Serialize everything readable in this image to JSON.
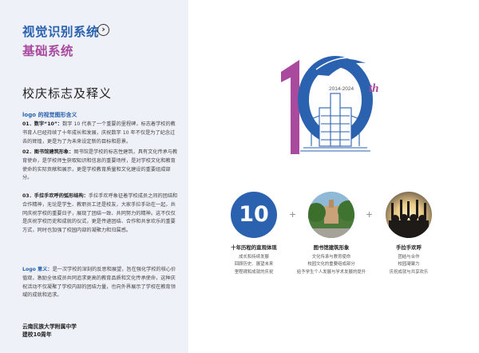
{
  "header": {
    "title_primary": "视觉识别系统",
    "title_secondary": "基础系统"
  },
  "section": {
    "title": "校庆标志及释义",
    "subtitle": "logo 的视觉图形含义",
    "items": [
      {
        "head": "01．数字“10”：",
        "text": "数字 10 代表了一个重要的里程碑，标志着学校的教书育人已经持续了十年成长和发展，庆祝数字 10 年不仅是为了纪念过去的辉煌，更是为了为未来设定新的目标和愿景。"
      },
      {
        "head": "02．图书馆建筑形象：",
        "text": "图书馆是学校的标志性建筑，具有文化传承与教育使命，是学校师生获取知识和信息的重要场所，是对学校文化和教育使命的实际贡献和展示，更是学校教育质量和文化建设的重要组成部分。"
      },
      {
        "head": "03．手拉手欢呼的弧形结构：",
        "text": "手拉手欢呼象征着学校成员之间的团结和合作精神，无论是学生、教职员工还是校友，大家手拉手站在一起，共同庆祝学校的重要日子，展现了团结一致、共同努力的精神。这不仅仅是庆祝学校历史和成就的仪式，更是传递团结、合作和共享欢乐的重要方式，同时也加强了校园内部的凝聚力和归属感。"
      }
    ],
    "meaning_head": "Logo 意义：",
    "meaning_text": "是一次学校的深刻的反思和展望，旨在强化学校的核心价值观，激励全体成员共同追求更高的教育品质和文化传承使命，这种庆祝活动不仅凝聚了学校内部的团结力量，也向外界展示了学校在教育领域的成就和追求。"
  },
  "footer": {
    "line1": "云南民族大学附属中学",
    "line2": "建校10周年"
  },
  "logo": {
    "years": "2014-2024",
    "suffix": "th"
  },
  "features": [
    {
      "badge": "10",
      "title": "十年历程的直观体现",
      "lines": [
        "成长和持续发展",
        "回顾历史、展望未来",
        "里程碑和成就的庆祝"
      ]
    },
    {
      "title": "图书馆建筑形象",
      "lines": [
        "文化传承与教育使命",
        "校园文化的重要组成部分",
        "给予学生个人发展与学术发展的提升"
      ]
    },
    {
      "title": "手拉手欢呼",
      "lines": [
        "团结与合作",
        "校园凝聚力",
        "庆祝成就与共享欢乐"
      ]
    }
  ],
  "colors": {
    "blue": "#2b62b0",
    "purple": "#a94a9f"
  }
}
